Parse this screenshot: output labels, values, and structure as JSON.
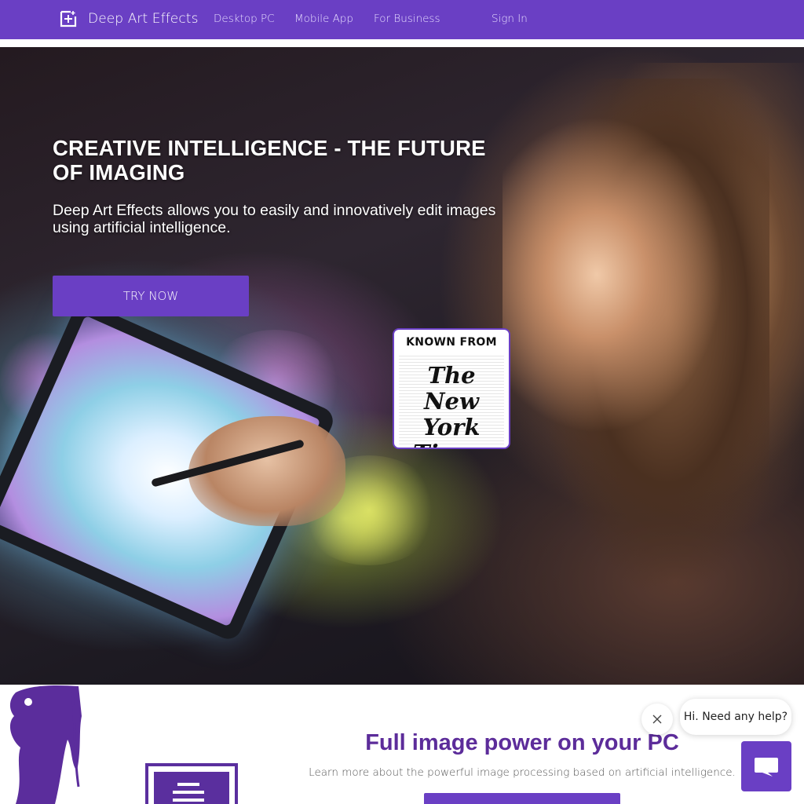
{
  "nav": {
    "brand": "Deep Art Effects",
    "links": [
      "Desktop PC",
      "Mobile App",
      "For Business",
      "Sign In"
    ]
  },
  "hero": {
    "title": "CREATIVE INTELLIGENCE - THE FUTURE OF IMAGING",
    "subtitle": "Deep Art Effects allows you to easily and innovatively edit images using artificial intelligence.",
    "cta": "TRY NOW",
    "badge": {
      "label": "KNOWN FROM",
      "logo": "The New York Times"
    }
  },
  "section": {
    "title": "Full image power on your PC",
    "subtitle": "Learn more about the powerful image processing based on artificial intelligence."
  },
  "chat": {
    "message": "Hi. Need any help?",
    "close_icon": "close-icon",
    "chat_icon": "chat-icon"
  },
  "colors": {
    "brand": "#6a3fc4",
    "heading": "#5c2c9a"
  }
}
